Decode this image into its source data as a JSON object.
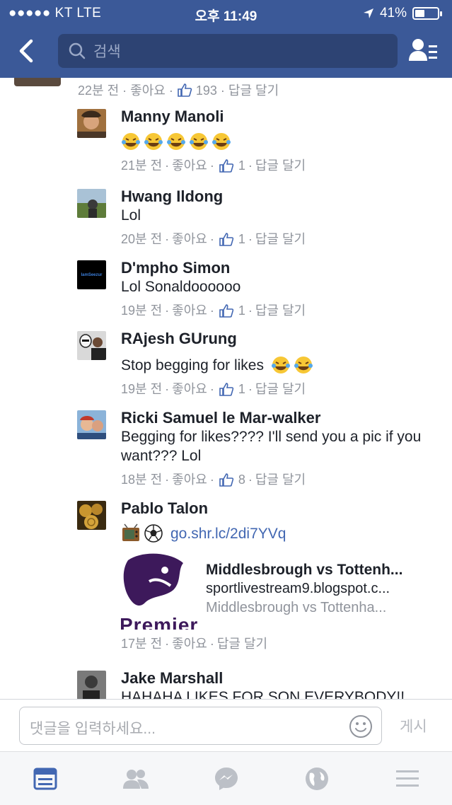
{
  "status_bar": {
    "carrier": "●●●●● KT  LTE",
    "time": "오후 11:49",
    "battery": "41%"
  },
  "header": {
    "search_placeholder": "검색"
  },
  "previous_comment": {
    "meta": "22분 전 · 좋아요 · ",
    "likes": "193",
    "reply": " · 답글 달기"
  },
  "comments": [
    {
      "author": "Manny Manoli",
      "text": "",
      "emoji_count": 5,
      "time": "21분 전",
      "like": "좋아요",
      "likes": "1",
      "reply": "답글 달기"
    },
    {
      "author": "Hwang Ildong",
      "text": "Lol",
      "time": "20분 전",
      "like": "좋아요",
      "likes": "1",
      "reply": "답글 달기"
    },
    {
      "author": "D'mpho Simon",
      "text": "Lol Sonaldoooooo",
      "avatar_text": "IamSeezur",
      "time": "19분 전",
      "like": "좋아요",
      "likes": "1",
      "reply": "답글 달기"
    },
    {
      "author": "RAjesh GUrung",
      "text": "Stop begging for likes",
      "time": "19분 전",
      "like": "좋아요",
      "likes": "1",
      "reply": "답글 달기"
    },
    {
      "author": "Ricki Samuel le Mar-walker",
      "text": "Begging for likes???? I'll send you a pic if you want??? Lol",
      "time": "18분 전",
      "like": "좋아요",
      "likes": "8",
      "reply": "답글 달기"
    },
    {
      "author": "Pablo Talon",
      "link": "go.shr.lc/2di7YVq",
      "time": "17분 전",
      "like": "좋아요",
      "reply": "답글 달기",
      "preview": {
        "title": "Middlesbrough vs Tottenh...",
        "domain": "sportlivestream9.blogspot.c...",
        "desc": "Middlesbrough vs Tottenha...",
        "logo_text": "Premier"
      }
    },
    {
      "author": "Jake Marshall",
      "text": "HAHAHA LIKES FOR SON EVERYBODY!!"
    }
  ],
  "composer": {
    "placeholder": "댓글을 입력하세요...",
    "post_label": "게시"
  },
  "tabs": [
    "news-feed",
    "friends",
    "messenger",
    "notifications",
    "menu"
  ]
}
